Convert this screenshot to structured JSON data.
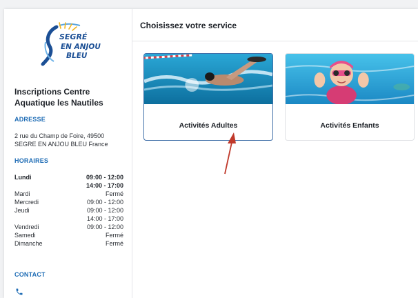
{
  "logo": {
    "line1": "SEGRÉ",
    "line2": "EN ANJOU",
    "line3": "BLEU"
  },
  "sidebar": {
    "title": "Inscriptions Centre Aquatique les Nautiles",
    "address_heading": "ADRESSE",
    "address_line1": "2 rue du Champ de Foire, 49500",
    "address_line2": "SEGRE EN ANJOU BLEU France",
    "hours_heading": "HORAIRES",
    "hours": [
      {
        "day": "Lundi",
        "times": [
          "09:00 - 12:00",
          "14:00 - 17:00"
        ],
        "bold": true
      },
      {
        "day": "Mardi",
        "times": [
          "Fermé"
        ],
        "bold": false
      },
      {
        "day": "Mercredi",
        "times": [
          "09:00 - 12:00"
        ],
        "bold": false
      },
      {
        "day": "Jeudi",
        "times": [
          "09:00 - 12:00",
          "14:00 - 17:00"
        ],
        "bold": false
      },
      {
        "day": "Vendredi",
        "times": [
          "09:00 - 12:00"
        ],
        "bold": false
      },
      {
        "day": "Samedi",
        "times": [
          "Fermé"
        ],
        "bold": false
      },
      {
        "day": "Dimanche",
        "times": [
          "Fermé"
        ],
        "bold": false
      }
    ],
    "contact_heading": "CONTACT",
    "contact_icon": "phone-icon"
  },
  "main": {
    "heading": "Choisissez votre service",
    "services": [
      {
        "label": "Activités Adultes",
        "image": "adult-swimmer-photo",
        "selected": true
      },
      {
        "label": "Activités Enfants",
        "image": "child-swimmer-photo",
        "selected": false
      }
    ]
  },
  "colors": {
    "accent": "#1e6cb5",
    "selected_border": "#3f6ea8",
    "annotation_arrow": "#c0392b"
  }
}
